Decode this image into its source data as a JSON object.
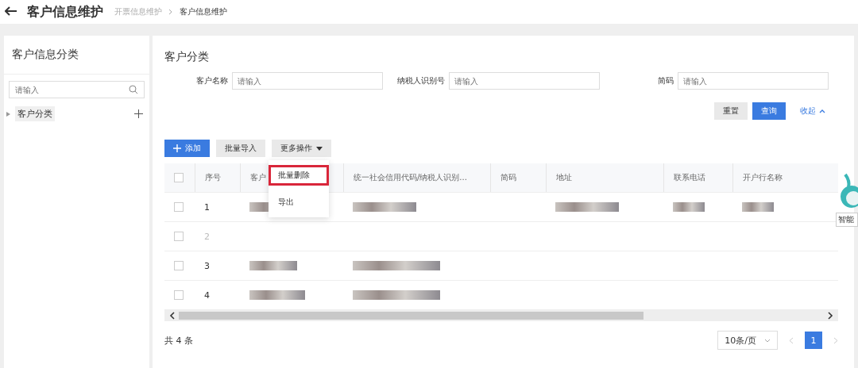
{
  "header": {
    "title": "客户信息维护",
    "breadcrumb": [
      "开票信息维护",
      "客户信息维护"
    ]
  },
  "sidebar": {
    "title": "客户信息分类",
    "search": {
      "placeholder": "请输入"
    },
    "tree": [
      {
        "label": "客户分类",
        "expanded": false,
        "selected": true
      }
    ]
  },
  "main": {
    "title": "客户分类",
    "filters": [
      {
        "label": "客户名称",
        "placeholder": "请输入"
      },
      {
        "label": "纳税人识别号",
        "placeholder": "请输入"
      },
      {
        "label": "简码",
        "placeholder": "请输入"
      }
    ],
    "filter_buttons": {
      "reset": "重置",
      "query": "查询",
      "collapse": "收起"
    },
    "toolbar": {
      "add": "添加",
      "import": "批量导入",
      "more": "更多操作"
    },
    "dropdown": [
      {
        "label": "批量删除",
        "highlighted": true
      },
      {
        "label": "导出",
        "highlighted": false
      }
    ],
    "table": {
      "select_all_checked": false,
      "columns": [
        "序号",
        "客户",
        "统一社会信用代码/纳税人识别...",
        "简码",
        "地址",
        "联系电话",
        "开户行名称"
      ],
      "rows": [
        {
          "index": "1",
          "disabled": false,
          "checked": false
        },
        {
          "index": "2",
          "disabled": true,
          "checked": false
        },
        {
          "index": "3",
          "disabled": false,
          "checked": false
        },
        {
          "index": "4",
          "disabled": false,
          "checked": false
        }
      ]
    },
    "footer": {
      "total": "共 4 条",
      "page_size": "10条/页",
      "pages": [
        {
          "label": "1",
          "selected": true
        }
      ]
    }
  },
  "assistant": {
    "label": "智能"
  }
}
